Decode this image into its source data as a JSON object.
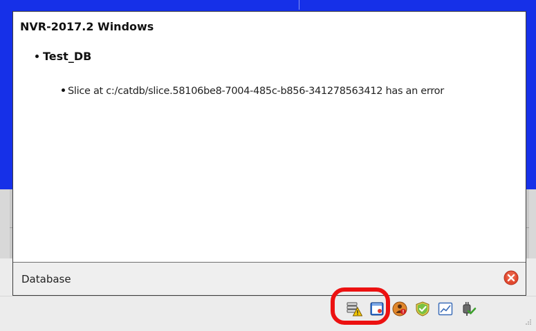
{
  "notification": {
    "app_title": "NVR-2017.2 Windows",
    "database_name": "Test_DB",
    "message": "Slice at c:/catdb/slice.58106be8-7004-485c-b856-341278563412 has an error",
    "footer_label": "Database"
  },
  "tray": {
    "icons": [
      "database-warning-icon",
      "window-icon",
      "user-alert-icon",
      "shield-check-icon",
      "chart-icon",
      "plug-check-icon"
    ]
  },
  "colors": {
    "background_blue": "#1630e8",
    "highlight_ring": "#ec1111",
    "close_icon": "#e2492f",
    "warning_yellow": "#f4c800"
  }
}
